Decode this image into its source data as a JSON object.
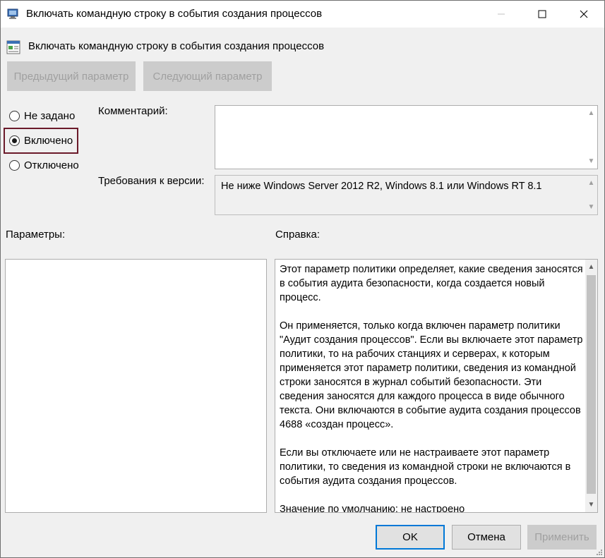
{
  "window": {
    "title": "Включать командную строку в события создания процессов"
  },
  "header": {
    "policy_title": "Включать командную строку в события создания процессов"
  },
  "nav": {
    "prev_label": "Предыдущий параметр",
    "next_label": "Следующий параметр"
  },
  "state": {
    "options": [
      {
        "label": "Не задано",
        "checked": false
      },
      {
        "label": "Включено",
        "checked": true
      },
      {
        "label": "Отключено",
        "checked": false
      }
    ]
  },
  "comment": {
    "label": "Комментарий:",
    "value": ""
  },
  "requirements": {
    "label": "Требования к версии:",
    "value": "Не ниже Windows Server 2012 R2, Windows 8.1 или Windows RT 8.1"
  },
  "options_panel": {
    "label": "Параметры:"
  },
  "help": {
    "label": "Справка:",
    "text": "Этот параметр политики определяет, какие сведения заносятся в события аудита безопасности, когда создается новый процесс.\n\nОн применяется, только когда включен параметр политики \"Аудит создания процессов\". Если вы включаете этот параметр политики, то на рабочих станциях и серверах, к которым применяется этот параметр политики, сведения из командной строки заносятся в журнал событий безопасности. Эти сведения заносятся для каждого процесса в виде обычного текста. Они включаются в событие аудита создания процессов 4688 «создан процесс».\n\nЕсли вы отключаете или не настраиваете этот параметр политики, то сведения из командной строки не включаются в события аудита создания процессов.\n\nЗначение по умолчанию: не настроено"
  },
  "buttons": {
    "ok": "OK",
    "cancel": "Отмена",
    "apply": "Применить"
  },
  "colors": {
    "accent": "#0078d7",
    "highlight_border": "#6b1a2a",
    "disabled_text": "#a0a0a0"
  }
}
